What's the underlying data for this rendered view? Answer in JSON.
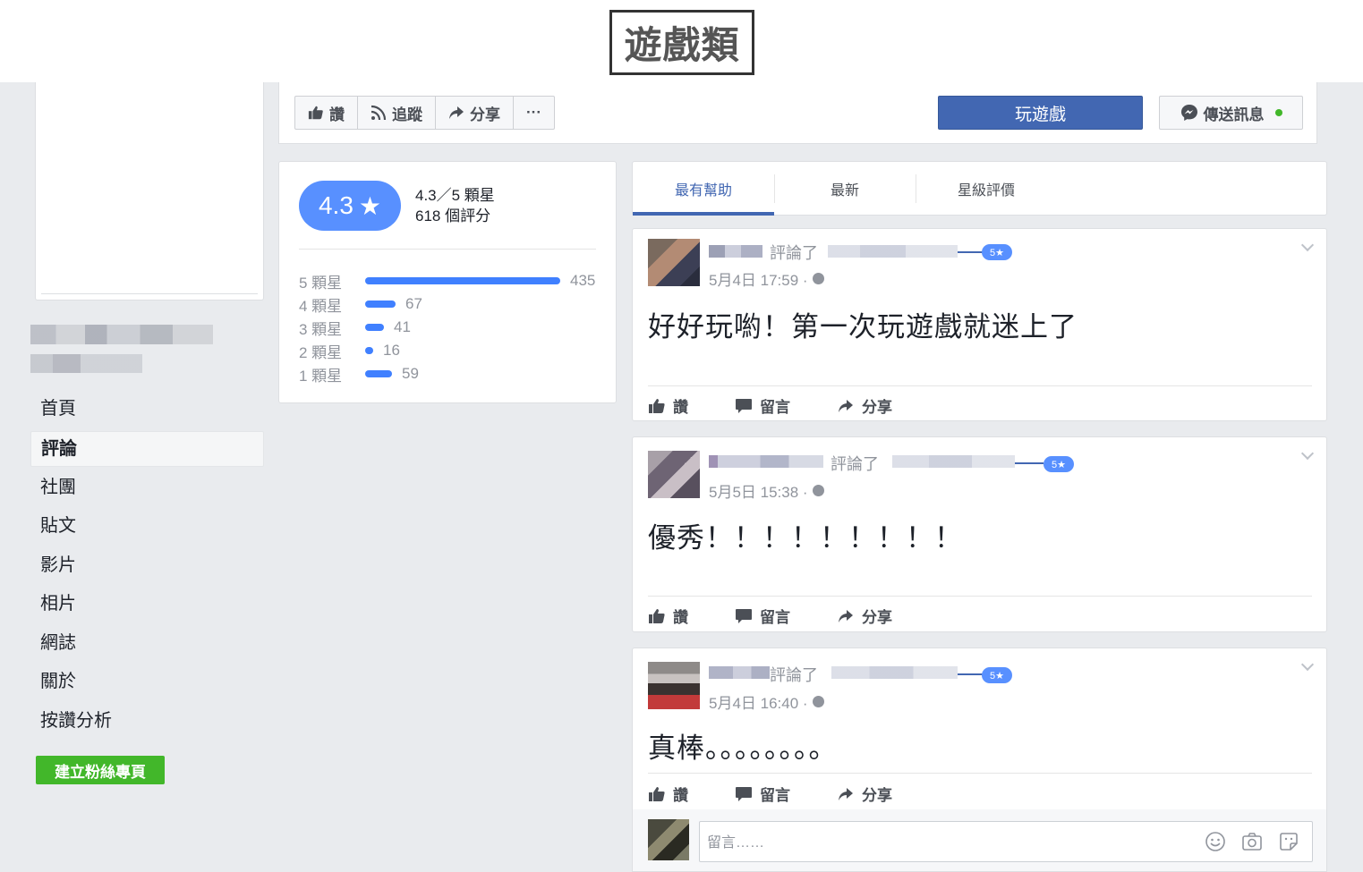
{
  "category_title": "遊戲類",
  "sidebar": {
    "items": [
      {
        "label": "首頁"
      },
      {
        "label": "評論"
      },
      {
        "label": "社團"
      },
      {
        "label": "貼文"
      },
      {
        "label": "影片"
      },
      {
        "label": "相片"
      },
      {
        "label": "網誌"
      },
      {
        "label": "關於"
      },
      {
        "label": "按讚分析"
      }
    ],
    "create_page_label": "建立粉絲專頁"
  },
  "action_bar": {
    "like_label": "讚",
    "follow_label": "追蹤",
    "share_label": "分享",
    "more_label": "···",
    "play_label": "玩遊戲",
    "message_label": "傳送訊息"
  },
  "rating": {
    "score": "4.3",
    "star_glyph": "★",
    "summary": "4.3／5 顆星",
    "count_label": "618 個評分",
    "distribution": [
      {
        "label": "5 顆星",
        "count": 435
      },
      {
        "label": "4 顆星",
        "count": 67
      },
      {
        "label": "3 顆星",
        "count": 41
      },
      {
        "label": "2 顆星",
        "count": 16
      },
      {
        "label": "1 顆星",
        "count": 59
      }
    ]
  },
  "tabs": [
    {
      "label": "最有幫助"
    },
    {
      "label": "最新"
    },
    {
      "label": "星級評價"
    }
  ],
  "reviews": [
    {
      "verb": "評論了",
      "badge": "5★",
      "date": "5月4日 17:59 ·",
      "text": "好好玩喲！第一次玩遊戲就迷上了"
    },
    {
      "verb": "評論了",
      "badge": "5★",
      "date": "5月5日 15:38 ·",
      "text": "優秀！！！！！！！！！"
    },
    {
      "verb": "評論了",
      "badge": "5★",
      "date": "5月4日 16:40 ·",
      "text": "真棒。。。。。。。。"
    }
  ],
  "review_actions": {
    "like": "讚",
    "comment": "留言",
    "share": "分享"
  },
  "comment": {
    "placeholder": "留言……"
  },
  "colors": {
    "brand": "#4267b2",
    "accent": "#5890ff",
    "bar": "#4080ff",
    "create": "#42b72a"
  }
}
